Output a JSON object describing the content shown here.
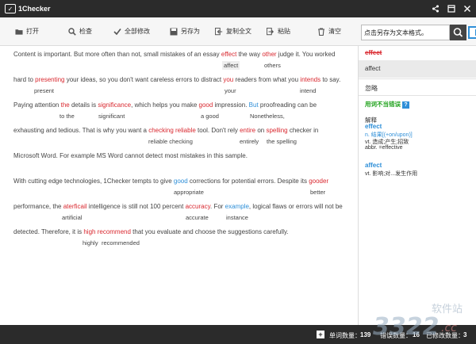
{
  "titlebar": {
    "title": "1Checker"
  },
  "toolbar": {
    "open": "打开",
    "check": "检查",
    "modify_all": "全部修改",
    "save_as": "另存为",
    "copy_all": "复制全文",
    "paste": "粘贴",
    "clear": "清空"
  },
  "search": {
    "value": "点击另存为文本格式。"
  },
  "editor": {
    "l1": {
      "a": "Content is important. But more often than not, small mistakes of an essay ",
      "e1": "effect",
      "b": " the way ",
      "e2": "other",
      "c": " judge it. You worked"
    },
    "s1": {
      "affect": "affect",
      "others": "others"
    },
    "l2": {
      "a": "hard to ",
      "e1": "presenting",
      "b": " your ideas, so you don't want careless errors to distract ",
      "e2": "you",
      "c": " readers from what you ",
      "e3": "intends",
      "d": " to say."
    },
    "s2": {
      "present": "present",
      "your": "your",
      "intend": "intend"
    },
    "l3": {
      "a": "Paying attention ",
      "e1": "the",
      "b": " details is ",
      "e2": "significance",
      "c": ", which helps you make ",
      "e3": "good",
      "d": " impression. ",
      "e4": "But",
      "f": " proofreading can be"
    },
    "s3": {
      "tothe": "to the",
      "significant": "significant",
      "agood": "a good",
      "nonetheless": "Nonetheless,"
    },
    "l4": {
      "a": "exhausting and tedious. That is why you want a ",
      "e1": "checking reliable",
      "b": " tool. Don't rely ",
      "e2": "entire",
      "c": " on ",
      "e3": "spelling",
      "d": " checker in"
    },
    "s4": {
      "reliable": "reliable checking",
      "entirely": "entirely",
      "thespelling": "the spelling"
    },
    "l5": "Microsoft Word. For example MS Word cannot detect most mistakes in this sample.",
    "l6": {
      "a": "With cutting edge technologies, 1Checker tempts to give ",
      "e1": "good",
      "b": " corrections for potential errors. Despite its ",
      "e2": "gooder"
    },
    "s6": {
      "appropriate": "appropriate",
      "better": "better"
    },
    "l7": {
      "a": "performance, the ",
      "e1": "aterficail",
      "b": " intelligence is still not 100 percent ",
      "e2": "accuracy",
      "c": ". For ",
      "e3": "example",
      "d": ", logical flaws or errors will not be"
    },
    "s7": {
      "artificial": "artificial",
      "accurate": "accurate",
      "instance": "instance"
    },
    "l8": {
      "a": "detected. Therefore, it is ",
      "e1": "high",
      "b": " ",
      "e2": "recommend",
      "c": " that you evaluate and choose the suggestions carefully."
    },
    "s8": {
      "highly": "highly",
      "recommended": "recommended"
    }
  },
  "sidebar": {
    "word": "effect",
    "suggestion": "affect",
    "ignore": "忽略",
    "report": "用词不当错误",
    "report_help": "?",
    "explain": "解释",
    "head1": "effect",
    "d1a": "n. 结果[(+on/upon)]",
    "d1b": "vt. 造成;产生;招致",
    "d1c": "abbr. =effective",
    "head2": "affect",
    "d2a": "vt. 影响;对...发生作用"
  },
  "status": {
    "words_label": "单词数量：",
    "words": "139",
    "errors_label": "错误数量：",
    "errors": "16",
    "fixed_label": "已修改数量：",
    "fixed": "3"
  },
  "colors": {
    "error": "#d9282f",
    "advice": "#2e8fd8",
    "accent": "#2e8fd8"
  },
  "icons": [
    "folder-icon",
    "search-icon",
    "check-all-icon",
    "save-icon",
    "copy-icon",
    "paste-icon",
    "clear-icon",
    "share-icon",
    "restore-icon",
    "close-icon",
    "plus-icon"
  ]
}
